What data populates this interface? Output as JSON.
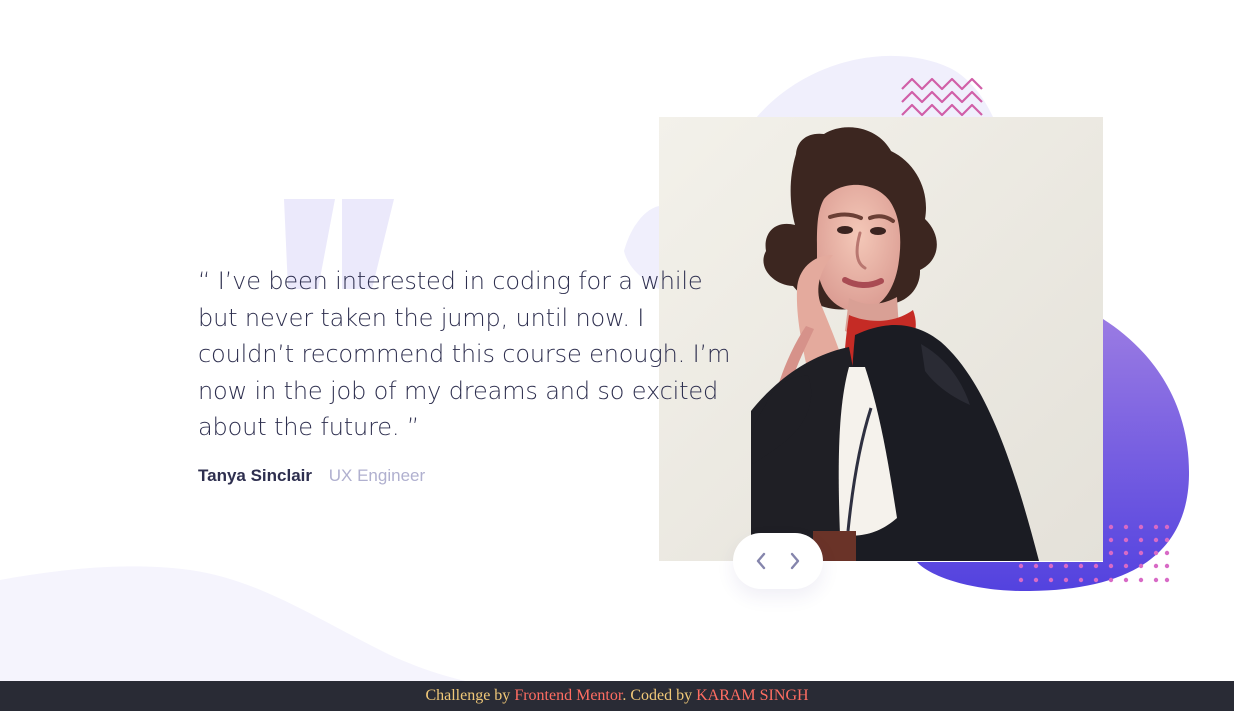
{
  "testimonial": {
    "quote": "“ I’ve been interested in coding for a while but never taken the jump, until now. I couldn’t recommend this course enough. I’m now in the job of my dreams and so excited about the future. ”",
    "author": "Tanya Sinclair",
    "role": "UX Engineer"
  },
  "controls": {
    "previous_label": "Previous",
    "next_label": "Next"
  },
  "footer": {
    "challenge_prefix": "Challenge by ",
    "challenge_link": "Frontend Mentor",
    "coded_prefix": ". Coded by ",
    "coder_link": "KARAM SINGH"
  },
  "icons": {
    "quote": "quote-icon",
    "previous": "chevron-left-icon",
    "next": "chevron-right-icon",
    "pattern": "zigzag-pattern"
  },
  "colors": {
    "text": "#2e2f4f",
    "muted": "#b0b0cf",
    "accent": "#7048e8",
    "pattern_pink": "#ce5ba5",
    "footer_bg": "#292b35",
    "footer_text": "#f0c878",
    "footer_link": "#ff6d62"
  }
}
